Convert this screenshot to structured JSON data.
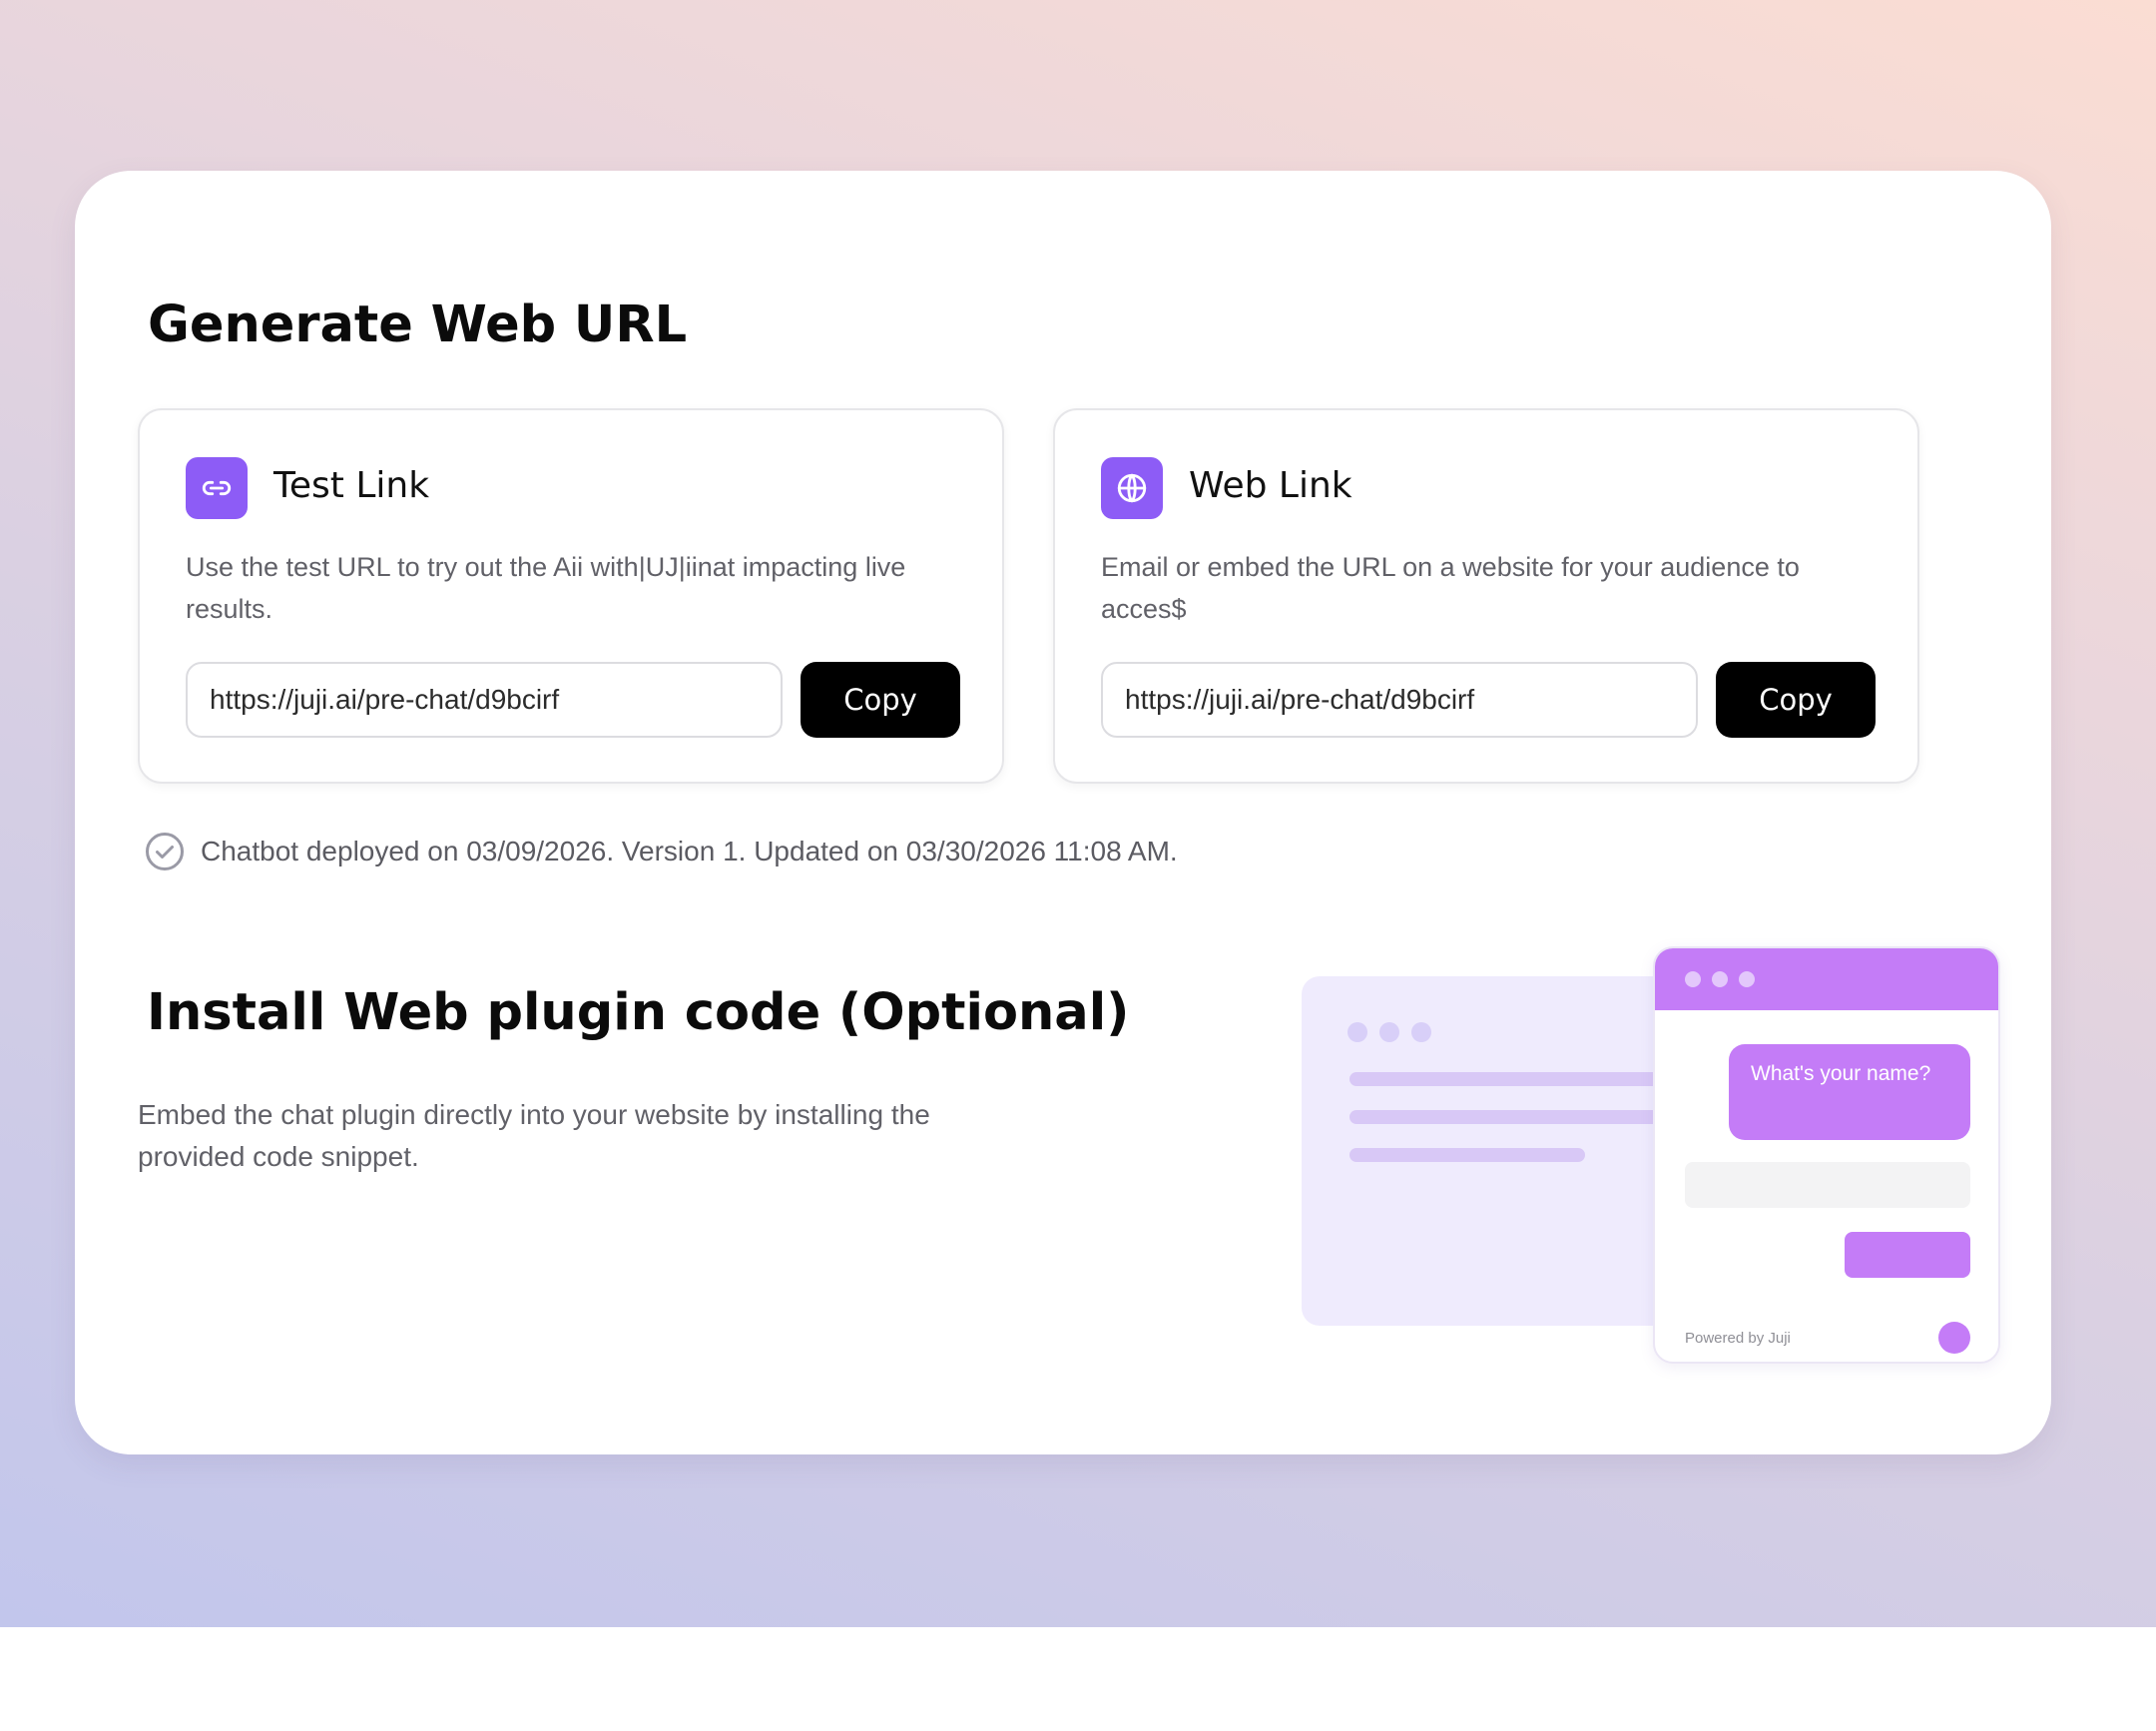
{
  "page": {
    "title": "Generate Web URL"
  },
  "test_card": {
    "icon": "link-icon",
    "title": "Test Link",
    "description": "Use the test URL to try out the Aii with|UJ|iinat impacting live results.",
    "url": "https://juji.ai/pre-chat/d9bcirf",
    "copy_label": "Copy"
  },
  "web_card": {
    "icon": "globe-icon",
    "title": "Web Link",
    "description": "Email or embed the URL on a website for your audience to acces$",
    "url": "https://juji.ai/pre-chat/d9bcirf",
    "copy_label": "Copy"
  },
  "status": {
    "icon": "check-circle-icon",
    "text": "Chatbot deployed on 03/09/2026. Version 1. Updated on 03/30/2026 11:08 AM."
  },
  "install": {
    "title": "Install Web plugin code (Optional)",
    "description": "Embed the chat plugin directly into your website by installing the provided code snippet."
  },
  "illustration": {
    "chat_bubble": "What's your name?",
    "powered_by": "Powered by Juji"
  },
  "colors": {
    "accent": "#8d5cf6",
    "chat_purple": "#c47cf7",
    "button": "#000000",
    "page_gradient": [
      "#fbddd3",
      "#c2c6ec"
    ]
  }
}
